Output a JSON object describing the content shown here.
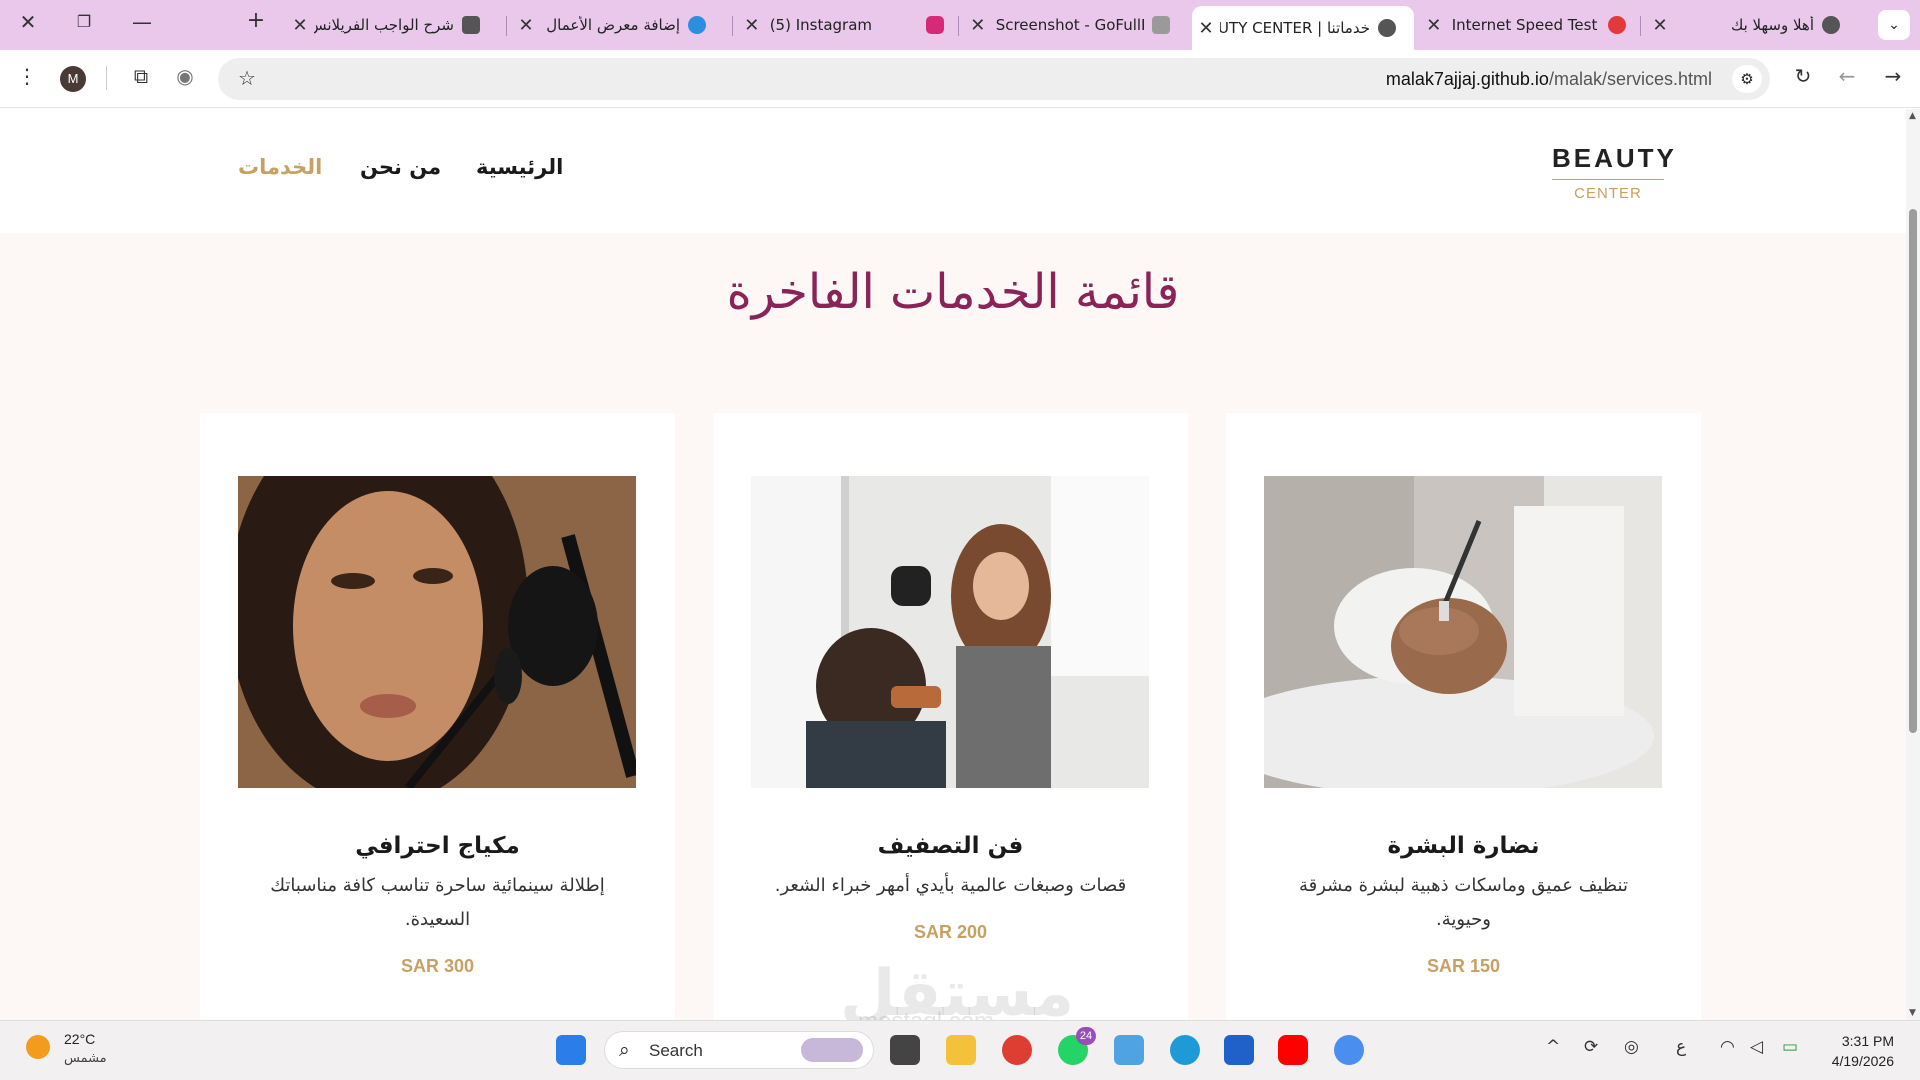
{
  "browser": {
    "tabs": [
      {
        "title": "أهلا وسهلا بك",
        "active": false
      },
      {
        "title": "Internet Speed Test |",
        "active": false
      },
      {
        "title": "خدماتنا | BEAUTY CENTER",
        "active": true
      },
      {
        "title": "Screenshot - GoFullP",
        "active": false
      },
      {
        "title": "(5) Instagram",
        "active": false
      },
      {
        "title": "إضافة معرض الأعمال",
        "active": false
      },
      {
        "title": "شرح الواجب الفريلانس",
        "active": false
      }
    ],
    "url_host": "malak7ajjaj.github.io",
    "url_path": "/malak/services.html",
    "profile_initial": "M"
  },
  "site": {
    "logo_top": "BEAUTY",
    "logo_bottom": "CENTER",
    "nav": {
      "home": "الرئيسية",
      "about": "من نحن",
      "services": "الخدمات"
    },
    "headline": "قائمة الخدمات الفاخرة",
    "cards": [
      {
        "title": "نضارة البشرة",
        "desc": "تنظيف عميق وماسكات ذهبية لبشرة مشرقة وحيوية.",
        "price": "SAR 150"
      },
      {
        "title": "فن التصفيف",
        "desc": "قصات وصبغات عالمية بأيدي أمهر خبراء الشعر.",
        "price": "SAR 200"
      },
      {
        "title": "مكياج احترافي",
        "desc": "إطلالة سينمائية ساحرة تناسب كافة مناسباتك السعيدة.",
        "price": "SAR 300"
      }
    ],
    "watermark": "مستقل",
    "watermark_sub": "mostaql.com"
  },
  "taskbar": {
    "temp": "22°C",
    "weather": "مشمس",
    "search": "Search",
    "whatsapp_badge": "24",
    "time": "3:31 PM",
    "date": "4/19/2026",
    "lang": "ع"
  },
  "colors": {
    "tabstrip": "#e9c8ec",
    "accent_gold": "#c8a063",
    "headline": "#8a2457",
    "page_bg": "#fdf8f6"
  }
}
